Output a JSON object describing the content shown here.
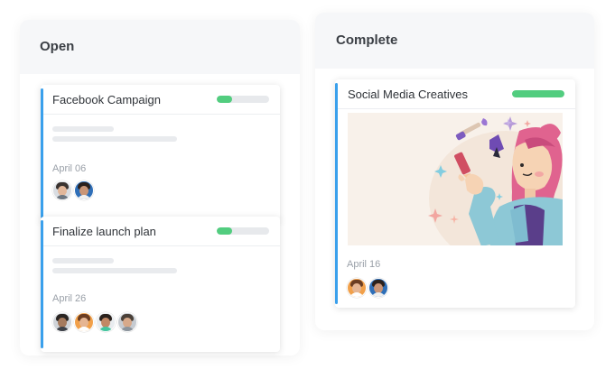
{
  "columns": {
    "open": {
      "title": "Open",
      "cards": [
        {
          "title": "Facebook Campaign",
          "progress": 0.3,
          "date": "April 06",
          "avatars": [
            "person-avatar-1",
            "person-avatar-2"
          ]
        },
        {
          "title": "Finalize launch plan",
          "progress": 0.3,
          "date": "April 26",
          "avatars": [
            "person-avatar-3",
            "person-avatar-4",
            "person-avatar-5",
            "person-avatar-6"
          ]
        }
      ]
    },
    "complete": {
      "title": "Complete",
      "cards": [
        {
          "title": "Social Media Creatives",
          "progress": 1.0,
          "date": "April 16",
          "avatars": [
            "person-avatar-7",
            "person-avatar-8"
          ]
        }
      ]
    }
  },
  "colors": {
    "accent": "#3aa0ec",
    "progress": "#52cd7f",
    "track": "#e7e9ec"
  }
}
